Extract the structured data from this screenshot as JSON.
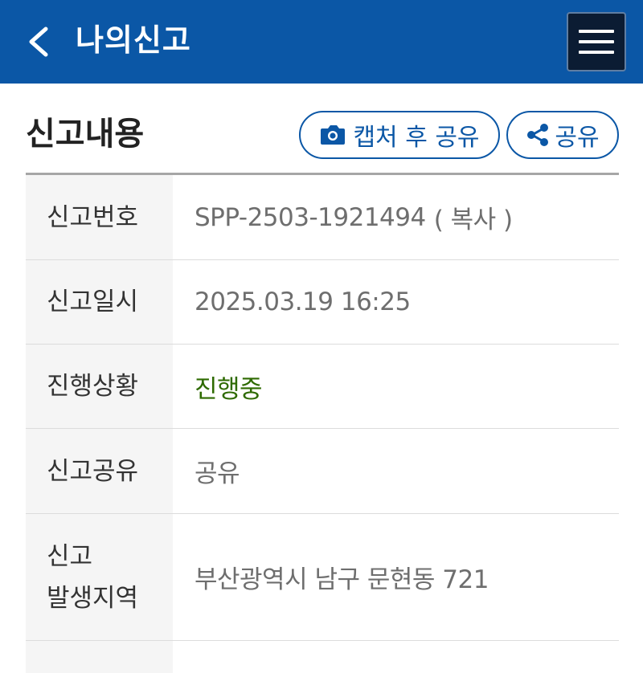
{
  "header": {
    "title": "나의신고",
    "back_icon": "chevron-left-icon",
    "menu_icon": "hamburger-menu-icon",
    "background_color": "#0b57a6"
  },
  "section": {
    "title": "신고내용",
    "capture_share_label": "캡처 후 공유",
    "capture_icon": "camera-icon",
    "share_label": "공유",
    "share_icon": "share-icon",
    "accent_color": "#0b57a6"
  },
  "rows": [
    {
      "label": "신고번호",
      "value": "SPP-2503-1921494",
      "action": "( 복사 )"
    },
    {
      "label": "신고일시",
      "value": "2025.03.19 16:25"
    },
    {
      "label": "진행상황",
      "value": "진행중",
      "value_color": "#2e6a00"
    },
    {
      "label": "신고공유",
      "value": "공유"
    },
    {
      "label_line1": "신고",
      "label_line2": "발생지역",
      "value": "부산광역시 남구 문현동 721"
    }
  ]
}
